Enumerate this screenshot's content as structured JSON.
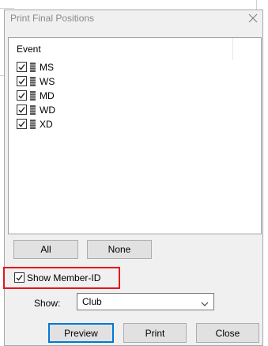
{
  "window": {
    "title": "Print Final Positions"
  },
  "list": {
    "header": "Event",
    "items": [
      {
        "label": "MS",
        "checked": true
      },
      {
        "label": "WS",
        "checked": true
      },
      {
        "label": "MD",
        "checked": true
      },
      {
        "label": "WD",
        "checked": true
      },
      {
        "label": "XD",
        "checked": true
      }
    ]
  },
  "selection": {
    "all_label": "All",
    "none_label": "None"
  },
  "options": {
    "show_member_id_label": "Show Member-ID",
    "show_member_id_checked": true,
    "show_label": "Show:",
    "show_value": "Club"
  },
  "actions": {
    "preview_label": "Preview",
    "print_label": "Print",
    "close_label": "Close"
  },
  "colors": {
    "highlight": "#e5141d",
    "default_button_border": "#0078d7"
  }
}
